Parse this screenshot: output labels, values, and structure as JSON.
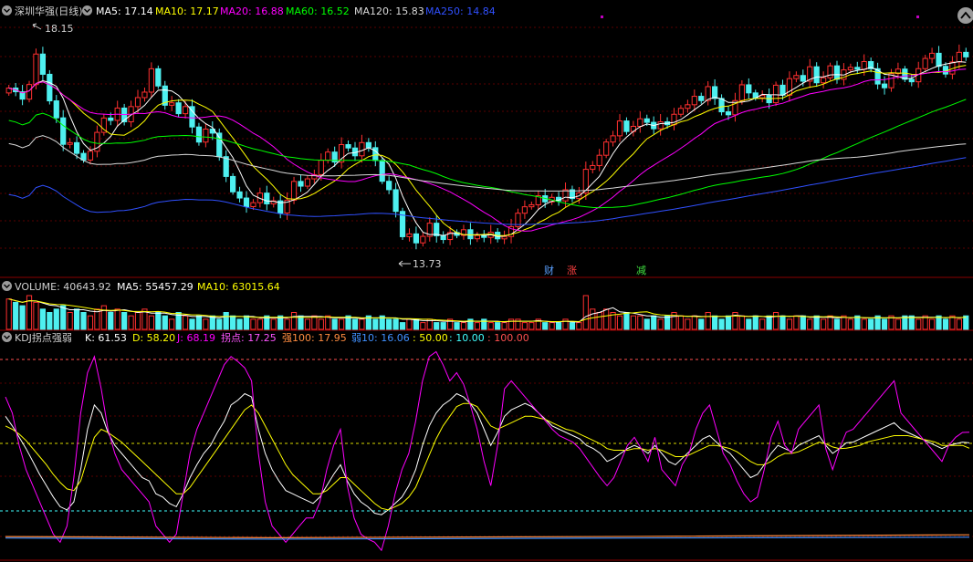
{
  "stock": {
    "name": "深圳华强(日线)"
  },
  "ma_legend": [
    {
      "label": "MA5: 17.14",
      "color": "#ffffff"
    },
    {
      "label": "MA10: 17.17",
      "color": "#ffff00"
    },
    {
      "label": "MA20: 16.88",
      "color": "#ff00ff"
    },
    {
      "label": "MA60: 16.52",
      "color": "#00ff00"
    },
    {
      "label": "MA120: 15.83",
      "color": "#d8d8d8"
    },
    {
      "label": "MA250: 14.84",
      "color": "#3050ff"
    }
  ],
  "annotations": {
    "high": "18.15",
    "low": "13.73"
  },
  "event_markers": [
    {
      "text": "财",
      "color": "#5aa0ff"
    },
    {
      "text": "涨",
      "color": "#ff4040"
    },
    {
      "text": "减",
      "color": "#40e040"
    }
  ],
  "volume_legend": {
    "title": {
      "label": "VOLUME: 40643.92",
      "color": "#d0d0d0"
    },
    "ma5": {
      "label": "MA5: 55457.29",
      "color": "#ffffff"
    },
    "ma10": {
      "label": "MA10: 63015.64",
      "color": "#ffff00"
    }
  },
  "kdj_legend": [
    {
      "label": "KDJ拐点强弱",
      "color": "#d0d0d0"
    },
    {
      "label": "K: 61.53",
      "color": "#ffffff"
    },
    {
      "label": "D: 58.20",
      "color": "#ffff00"
    },
    {
      "label": "J: 68.19",
      "color": "#ff00ff"
    },
    {
      "label": "拐点: 17.25",
      "color": "#ff55ff"
    },
    {
      "label": "强100: 17.95",
      "color": "#ff8c40"
    },
    {
      "label": "弱10: 16.06",
      "color": "#4090ff"
    },
    {
      "label": ": 50.00",
      "color": "#ffff00"
    },
    {
      "label": ": 10.00",
      "color": "#40ffff"
    },
    {
      "label": ": 100.00",
      "color": "#ff5050"
    }
  ],
  "chart_data": [
    {
      "type": "candlestick",
      "title": "深圳华强(日线)",
      "ylim": [
        13.4,
        18.6
      ],
      "up_color": "#ff3030",
      "down_color": "#4ef0f0",
      "close_start": 16.8,
      "daily_returns_pct": [
        0.8,
        -0.6,
        -1.2,
        2.4,
        4.9,
        -3.1,
        -4.2,
        -2.8,
        -4.5,
        0.3,
        -1.9,
        -1.2,
        1.6,
        3.4,
        2.5,
        -0.4,
        2.1,
        -2.3,
        2.6,
        1.5,
        0.9,
        3.8,
        -2.7,
        -3.1,
        0.4,
        -1.8,
        1.2,
        -3.4,
        -2.6,
        2.3,
        -0.7,
        -4.1,
        -3.6,
        -2.9,
        -1.2,
        -1.7,
        0.8,
        1.9,
        -2.1,
        0.6,
        -2.4,
        2.6,
        3.7,
        -0.9,
        1.4,
        0.8,
        2.7,
        1.5,
        -1.8,
        3.2,
        -0.6,
        -1.4,
        2.4,
        -0.9,
        -2.3,
        -3.8,
        -1.6,
        -4.2,
        -5.1,
        0.6,
        -1.9,
        1.4,
        2.8,
        -2.6,
        -0.8,
        1.5,
        -0.6,
        1.2,
        -1.9,
        0.7,
        -0.4,
        1.1,
        -1.4,
        0.5,
        2.1,
        2.8,
        1.3,
        0.4,
        1.8,
        -1.2,
        0.9,
        -0.7,
        2.2,
        -1.7,
        1.1,
        4.6,
        0.7,
        1.9,
        2.4,
        1.1,
        2.6,
        -1.8,
        0.9,
        1.3,
        -0.6,
        -1.1,
        1.2,
        -0.5,
        1.8,
        1.0,
        0.6,
        1.4,
        -0.7,
        2.3,
        -1.9,
        -2.2,
        -0.5,
        2.4,
        2.6,
        -1.3,
        -0.8,
        0.4,
        -1.2,
        2.9,
        -1.6,
        2.7,
        0.5,
        -0.9,
        2.3,
        -2.5,
        0.8,
        1.9,
        -2.1,
        1.5,
        0.4,
        -0.3,
        1.2,
        -1.1,
        -2.4,
        -0.6,
        2.3,
        0.7,
        -1.6,
        -0.4,
        2.1,
        1.6,
        0.8,
        -2.0,
        -1.2,
        1.9,
        1.5,
        -0.7
      ],
      "ma_lines": [
        {
          "name": "MA5",
          "period": 5,
          "value": 17.14
        },
        {
          "name": "MA10",
          "period": 10,
          "value": 17.17
        },
        {
          "name": "MA20",
          "period": 20,
          "value": 16.88
        },
        {
          "name": "MA60",
          "period": 60,
          "value": 16.52
        },
        {
          "name": "MA120",
          "period": 120,
          "value": 15.83
        },
        {
          "name": "MA250",
          "period": 250,
          "value": 14.84
        }
      ],
      "annotated_high": 18.15,
      "annotated_low": 13.73
    },
    {
      "type": "bar",
      "title": "VOLUME",
      "last_value": 40643.92,
      "ma5": 55457.29,
      "ma10": 63015.64,
      "relative_volume": [
        0.9,
        0.8,
        0.7,
        1.0,
        0.8,
        0.6,
        0.5,
        0.6,
        0.7,
        0.5,
        0.6,
        0.5,
        0.4,
        0.6,
        0.7,
        0.5,
        0.6,
        0.5,
        0.4,
        0.5,
        0.6,
        0.4,
        0.5,
        0.4,
        0.3,
        0.5,
        0.4,
        0.3,
        0.4,
        0.3,
        0.4,
        0.3,
        0.5,
        0.4,
        0.3,
        0.4,
        0.3,
        0.3,
        0.4,
        0.3,
        0.4,
        0.3,
        0.5,
        0.4,
        0.3,
        0.4,
        0.3,
        0.4,
        0.3,
        0.3,
        0.4,
        0.3,
        0.3,
        0.4,
        0.3,
        0.4,
        0.3,
        0.3,
        0.2,
        0.3,
        0.3,
        0.2,
        0.3,
        0.2,
        0.2,
        0.3,
        0.2,
        0.2,
        0.3,
        0.2,
        0.3,
        0.2,
        0.2,
        0.2,
        0.3,
        0.3,
        0.2,
        0.2,
        0.3,
        0.2,
        0.2,
        0.2,
        0.3,
        0.2,
        0.2,
        1.0,
        0.6,
        0.5,
        0.6,
        0.5,
        0.4,
        0.5,
        0.4,
        0.4,
        0.3,
        0.4,
        0.3,
        0.4,
        0.5,
        0.4,
        0.3,
        0.4,
        0.3,
        0.5,
        0.4,
        0.3,
        0.4,
        0.5,
        0.4,
        0.3,
        0.4,
        0.3,
        0.4,
        0.5,
        0.4,
        0.3,
        0.4,
        0.4,
        0.3,
        0.4,
        0.3,
        0.4,
        0.3,
        0.4,
        0.3,
        0.4,
        0.3,
        0.3,
        0.4,
        0.3,
        0.4,
        0.3,
        0.4,
        0.4,
        0.3,
        0.4,
        0.3,
        0.4,
        0.3,
        0.4,
        0.3,
        0.4
      ]
    },
    {
      "type": "line",
      "title": "KDJ拐点强弱",
      "ylim": [
        -10,
        120
      ],
      "reference_lines": [
        100,
        50,
        10
      ],
      "series": [
        {
          "name": "K",
          "color": "#ffffff",
          "last": 61.53,
          "values": [
            78,
            72,
            65,
            58,
            50,
            42,
            35,
            28,
            22,
            20,
            25,
            45,
            70,
            85,
            80,
            68,
            60,
            55,
            50,
            45,
            40,
            38,
            30,
            28,
            24,
            22,
            30,
            40,
            48,
            55,
            60,
            68,
            75,
            85,
            88,
            92,
            90,
            70,
            55,
            45,
            38,
            32,
            30,
            28,
            26,
            24,
            28,
            35,
            42,
            48,
            38,
            30,
            25,
            22,
            18,
            17,
            20,
            24,
            28,
            35,
            45,
            60,
            72,
            80,
            85,
            88,
            92,
            90,
            86,
            80,
            70,
            60,
            68,
            78,
            82,
            84,
            86,
            84,
            80,
            76,
            72,
            70,
            68,
            66,
            64,
            60,
            58,
            55,
            50,
            52,
            55,
            58,
            60,
            58,
            55,
            60,
            55,
            50,
            48,
            52,
            56,
            60,
            64,
            66,
            62,
            58,
            55,
            50,
            45,
            40,
            42,
            48,
            55,
            60,
            58,
            56,
            60,
            62,
            64,
            66,
            60,
            55,
            58,
            61.53,
            62,
            64,
            66,
            68,
            70,
            72,
            74,
            70,
            68,
            66,
            64,
            62,
            60,
            58,
            60,
            61,
            62,
            61.53
          ]
        },
        {
          "name": "D",
          "color": "#ffff00",
          "last": 58.2,
          "values": [
            72,
            70,
            67,
            63,
            58,
            53,
            48,
            42,
            37,
            33,
            32,
            38,
            52,
            65,
            70,
            68,
            65,
            62,
            58,
            54,
            50,
            46,
            42,
            38,
            34,
            30,
            30,
            34,
            40,
            46,
            52,
            58,
            64,
            70,
            76,
            82,
            85,
            80,
            72,
            64,
            56,
            48,
            42,
            38,
            34,
            30,
            30,
            32,
            36,
            40,
            40,
            36,
            32,
            28,
            24,
            21,
            20,
            22,
            24,
            28,
            34,
            44,
            54,
            64,
            72,
            78,
            84,
            86,
            86,
            84,
            78,
            72,
            70,
            72,
            74,
            76,
            78,
            78,
            77,
            76,
            74,
            72,
            70,
            69,
            67,
            65,
            63,
            61,
            58,
            57,
            57,
            57,
            58,
            58,
            57,
            58,
            57,
            55,
            53,
            53,
            54,
            56,
            58,
            60,
            60,
            59,
            58,
            56,
            53,
            50,
            48,
            48,
            50,
            53,
            55,
            55,
            56,
            58,
            60,
            62,
            61,
            59,
            58,
            58.2,
            59,
            60,
            62,
            63,
            64,
            65,
            66,
            66,
            66,
            65,
            64,
            63,
            62,
            60,
            60,
            60,
            60,
            58.2
          ]
        },
        {
          "name": "J",
          "color": "#ff00ff",
          "last": 68.19,
          "values": [
            90,
            80,
            60,
            45,
            35,
            25,
            15,
            5,
            0,
            10,
            40,
            80,
            105,
            115,
            95,
            70,
            55,
            45,
            40,
            35,
            30,
            25,
            10,
            5,
            0,
            5,
            30,
            55,
            70,
            80,
            90,
            100,
            110,
            115,
            112,
            108,
            100,
            55,
            25,
            10,
            5,
            0,
            5,
            10,
            15,
            15,
            25,
            45,
            60,
            70,
            35,
            15,
            5,
            2,
            0,
            -5,
            10,
            30,
            45,
            55,
            75,
            100,
            115,
            118,
            110,
            100,
            105,
            98,
            85,
            70,
            50,
            35,
            60,
            95,
            100,
            95,
            90,
            85,
            80,
            75,
            70,
            66,
            64,
            62,
            58,
            52,
            46,
            40,
            35,
            40,
            50,
            60,
            65,
            58,
            50,
            65,
            45,
            40,
            35,
            48,
            55,
            70,
            80,
            85,
            70,
            55,
            48,
            38,
            30,
            25,
            28,
            45,
            65,
            75,
            60,
            55,
            70,
            75,
            80,
            85,
            58,
            45,
            58,
            68.19,
            70,
            75,
            80,
            85,
            90,
            95,
            100,
            80,
            75,
            70,
            65,
            60,
            55,
            50,
            60,
            65,
            68,
            68.19
          ]
        },
        {
          "name": "强100",
          "color": "#ff8c40",
          "last": 17.95
        },
        {
          "name": "弱10",
          "color": "#4090ff",
          "last": 16.06
        },
        {
          "name": "拐点",
          "color": "#ff55ff",
          "last": 17.25
        }
      ]
    }
  ]
}
